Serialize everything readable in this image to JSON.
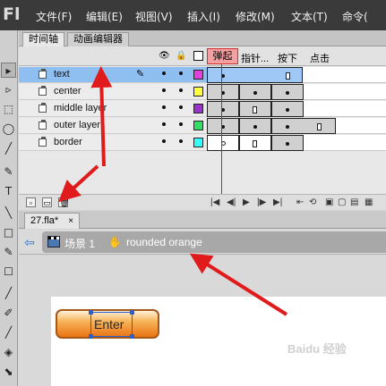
{
  "app": {
    "logo": "Fl"
  },
  "menu": [
    "文件(F)",
    "编辑(E)",
    "视图(V)",
    "插入(I)",
    "修改(M)",
    "文本(T)",
    "命令("
  ],
  "tools": [
    "▸",
    "▹",
    "⬚",
    "◯",
    "╱",
    "✎",
    "T",
    "╲",
    "□",
    "✎",
    "☐",
    "╱",
    "✐",
    "╱",
    "◈",
    "⬊"
  ],
  "timeline": {
    "tabs": [
      "时间轴",
      "动画编辑器"
    ],
    "frame_labels": [
      "弹起",
      "指针...",
      "按下",
      "点击"
    ],
    "layers": [
      {
        "name": "text",
        "color": "#e040e0",
        "selected": true
      },
      {
        "name": "center",
        "color": "#ffff40",
        "selected": false
      },
      {
        "name": "middle layer",
        "color": "#9933cc",
        "selected": false
      },
      {
        "name": "outer layer",
        "color": "#33dd66",
        "selected": false
      },
      {
        "name": "border",
        "color": "#33ffff",
        "selected": false
      }
    ],
    "colors": {
      "accent": "#cc2222",
      "selected_row": "#8fbef0"
    }
  },
  "document": {
    "tab": "27.fla*",
    "tab_close": "×",
    "scene": "场景 1",
    "symbol": "rounded orange",
    "button_text": "Enter",
    "watermark": "Baidu 经验"
  }
}
